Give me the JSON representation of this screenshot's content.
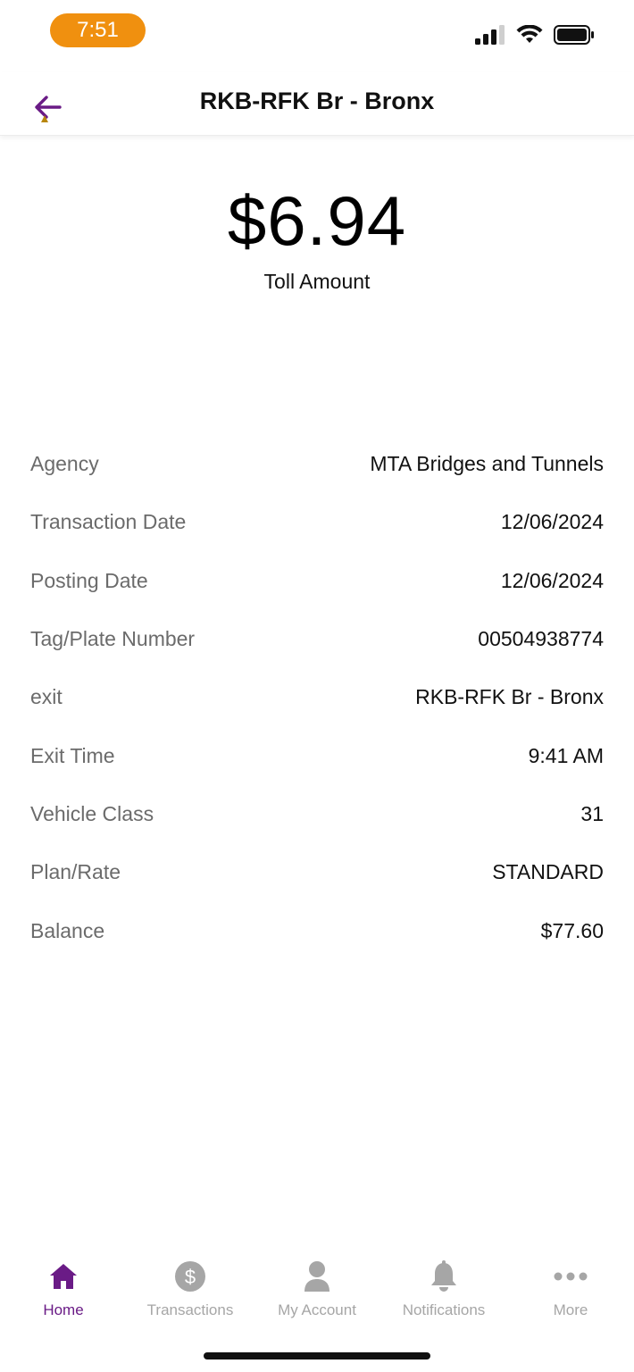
{
  "status_bar": {
    "time": "7:51",
    "time_pill_color": "#f0900f",
    "icons": [
      "signal-icon",
      "wifi-icon",
      "battery-icon"
    ]
  },
  "header": {
    "title": "RKB-RFK Br - Bronx",
    "back_icon": "back-arrow-icon",
    "accent_color": "#6a1b86"
  },
  "toll": {
    "amount": "$6.94",
    "label": "Toll Amount"
  },
  "details": [
    {
      "label": "Agency",
      "value": "MTA Bridges and Tunnels"
    },
    {
      "label": "Transaction Date",
      "value": "12/06/2024"
    },
    {
      "label": "Posting Date",
      "value": "12/06/2024"
    },
    {
      "label": "Tag/Plate Number",
      "value": "00504938774"
    },
    {
      "label": "exit",
      "value": "RKB-RFK Br - Bronx"
    },
    {
      "label": "Exit Time",
      "value": "9:41 AM"
    },
    {
      "label": "Vehicle Class",
      "value": "31"
    },
    {
      "label": "Plan/Rate",
      "value": "STANDARD"
    },
    {
      "label": "Balance",
      "value": "$77.60"
    }
  ],
  "tabbar": {
    "items": [
      {
        "label": "Home",
        "icon": "home-icon",
        "active": true
      },
      {
        "label": "Transactions",
        "icon": "dollar-circle-icon",
        "active": false
      },
      {
        "label": "My Account",
        "icon": "person-icon",
        "active": false
      },
      {
        "label": "Notifications",
        "icon": "bell-icon",
        "active": false
      },
      {
        "label": "More",
        "icon": "more-dots-icon",
        "active": false
      }
    ],
    "active_color": "#6a1b86",
    "inactive_color": "#a6a6a6"
  }
}
